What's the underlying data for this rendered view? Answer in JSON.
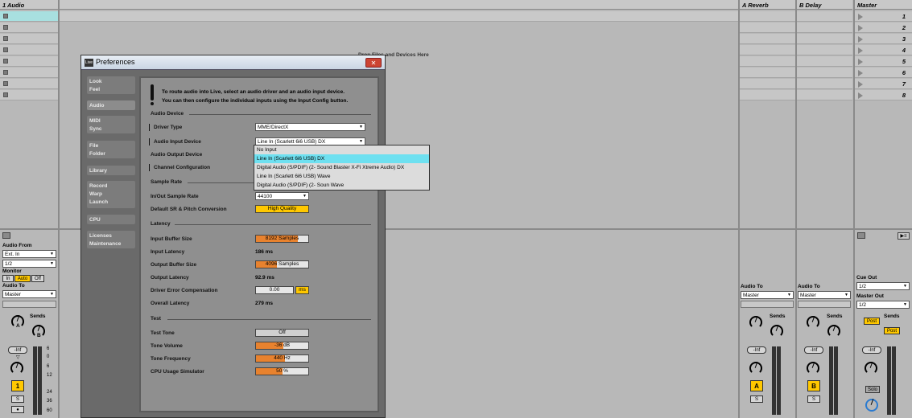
{
  "tracks": {
    "audio_track_name": "1 Audio",
    "reverb_name": "A Reverb",
    "delay_name": "B Delay",
    "master_name": "Master"
  },
  "scenes": [
    "1",
    "2",
    "3",
    "4",
    "5",
    "6",
    "7",
    "8"
  ],
  "drop_hint": "Drop Files and Devices Here",
  "io": {
    "audio_from_label": "Audio From",
    "audio_from_value": "Ext. In",
    "input_channel": "1/2",
    "monitor_label": "Monitor",
    "monitor_in": "In",
    "monitor_auto": "Auto",
    "monitor_off": "Off",
    "audio_to_label": "Audio To",
    "audio_to_value": "Master",
    "sends_label": "Sends",
    "send_a": "A",
    "send_b": "B",
    "volume_value": "-Inf",
    "track_number": "1",
    "solo_short": "S",
    "reverb_audio_to": "Audio To",
    "reverb_audio_to_value": "Master",
    "delay_audio_to": "Audio To",
    "delay_audio_to_value": "Master",
    "return_a": "A",
    "return_b": "B",
    "cue_out_label": "Cue Out",
    "cue_out_value": "1/2",
    "master_out_label": "Master Out",
    "master_out_value": "1/2",
    "post_label": "Post",
    "solo_label": "Solo"
  },
  "meter_ticks": [
    "6",
    "0",
    "6",
    "12",
    "24",
    "36",
    "60"
  ],
  "preferences": {
    "title": "Preferences",
    "logo": "Live",
    "close": "✕",
    "tabs": [
      {
        "label": "Look\nFeel"
      },
      {
        "label": "Audio"
      },
      {
        "label": "MIDI\nSync"
      },
      {
        "label": "File\nFolder"
      },
      {
        "label": "Library"
      },
      {
        "label": "Record\nWarp\nLaunch"
      },
      {
        "label": "CPU"
      },
      {
        "label": "Licenses\nMaintenance"
      }
    ],
    "info_line1": "To route audio into Live, select an audio driver and an audio input device.",
    "info_line2": "You can then configure the individual inputs using the Input Config button.",
    "audio_device_section": "Audio Device",
    "driver_type_label": "Driver Type",
    "driver_type_value": "MME/DirectX",
    "audio_input_device_label": "Audio Input Device",
    "audio_input_device_value": "Line In (Scarlett 6i6 USB) DX",
    "audio_output_device_label": "Audio Output Device",
    "channel_config_label": "Channel Configuration",
    "sample_rate_section": "Sample Rate",
    "in_out_sample_rate_label": "In/Out Sample Rate",
    "in_out_sample_rate_value": "44100",
    "default_sr_label": "Default SR & Pitch Conversion",
    "default_sr_value": "High Quality",
    "latency_section": "Latency",
    "input_buffer_label": "Input Buffer Size",
    "input_buffer_value": "8192 Samples",
    "input_latency_label": "Input Latency",
    "input_latency_value": "186 ms",
    "output_buffer_label": "Output Buffer Size",
    "output_buffer_value": "4096 Samples",
    "output_latency_label": "Output Latency",
    "output_latency_value": "92.9 ms",
    "driver_error_label": "Driver Error Compensation",
    "driver_error_value": "0.00",
    "driver_error_unit": "ms",
    "overall_latency_label": "Overall Latency",
    "overall_latency_value": "279 ms",
    "test_section": "Test",
    "test_tone_label": "Test Tone",
    "test_tone_value": "Off",
    "tone_volume_label": "Tone Volume",
    "tone_volume_value": "-36 dB",
    "tone_freq_label": "Tone Frequency",
    "tone_freq_value": "440 Hz",
    "cpu_sim_label": "CPU Usage Simulator",
    "cpu_sim_value": "50 %",
    "input_device_options": [
      "No Input",
      "Line In (Scarlett 6i6 USB) DX",
      "Digital Audio (S/PDIF) (2- Sound Blaster X-Fi Xtreme Audio) DX",
      "Line In (Scarlett 6i6 USB) Wave",
      "Digital Audio (S/PDIF) (2- Soun Wave"
    ],
    "highlighted_option": 1
  },
  "colors": {
    "accent": "#ffc800",
    "orange": "#e8822e",
    "highlight": "#6ee0f0"
  }
}
